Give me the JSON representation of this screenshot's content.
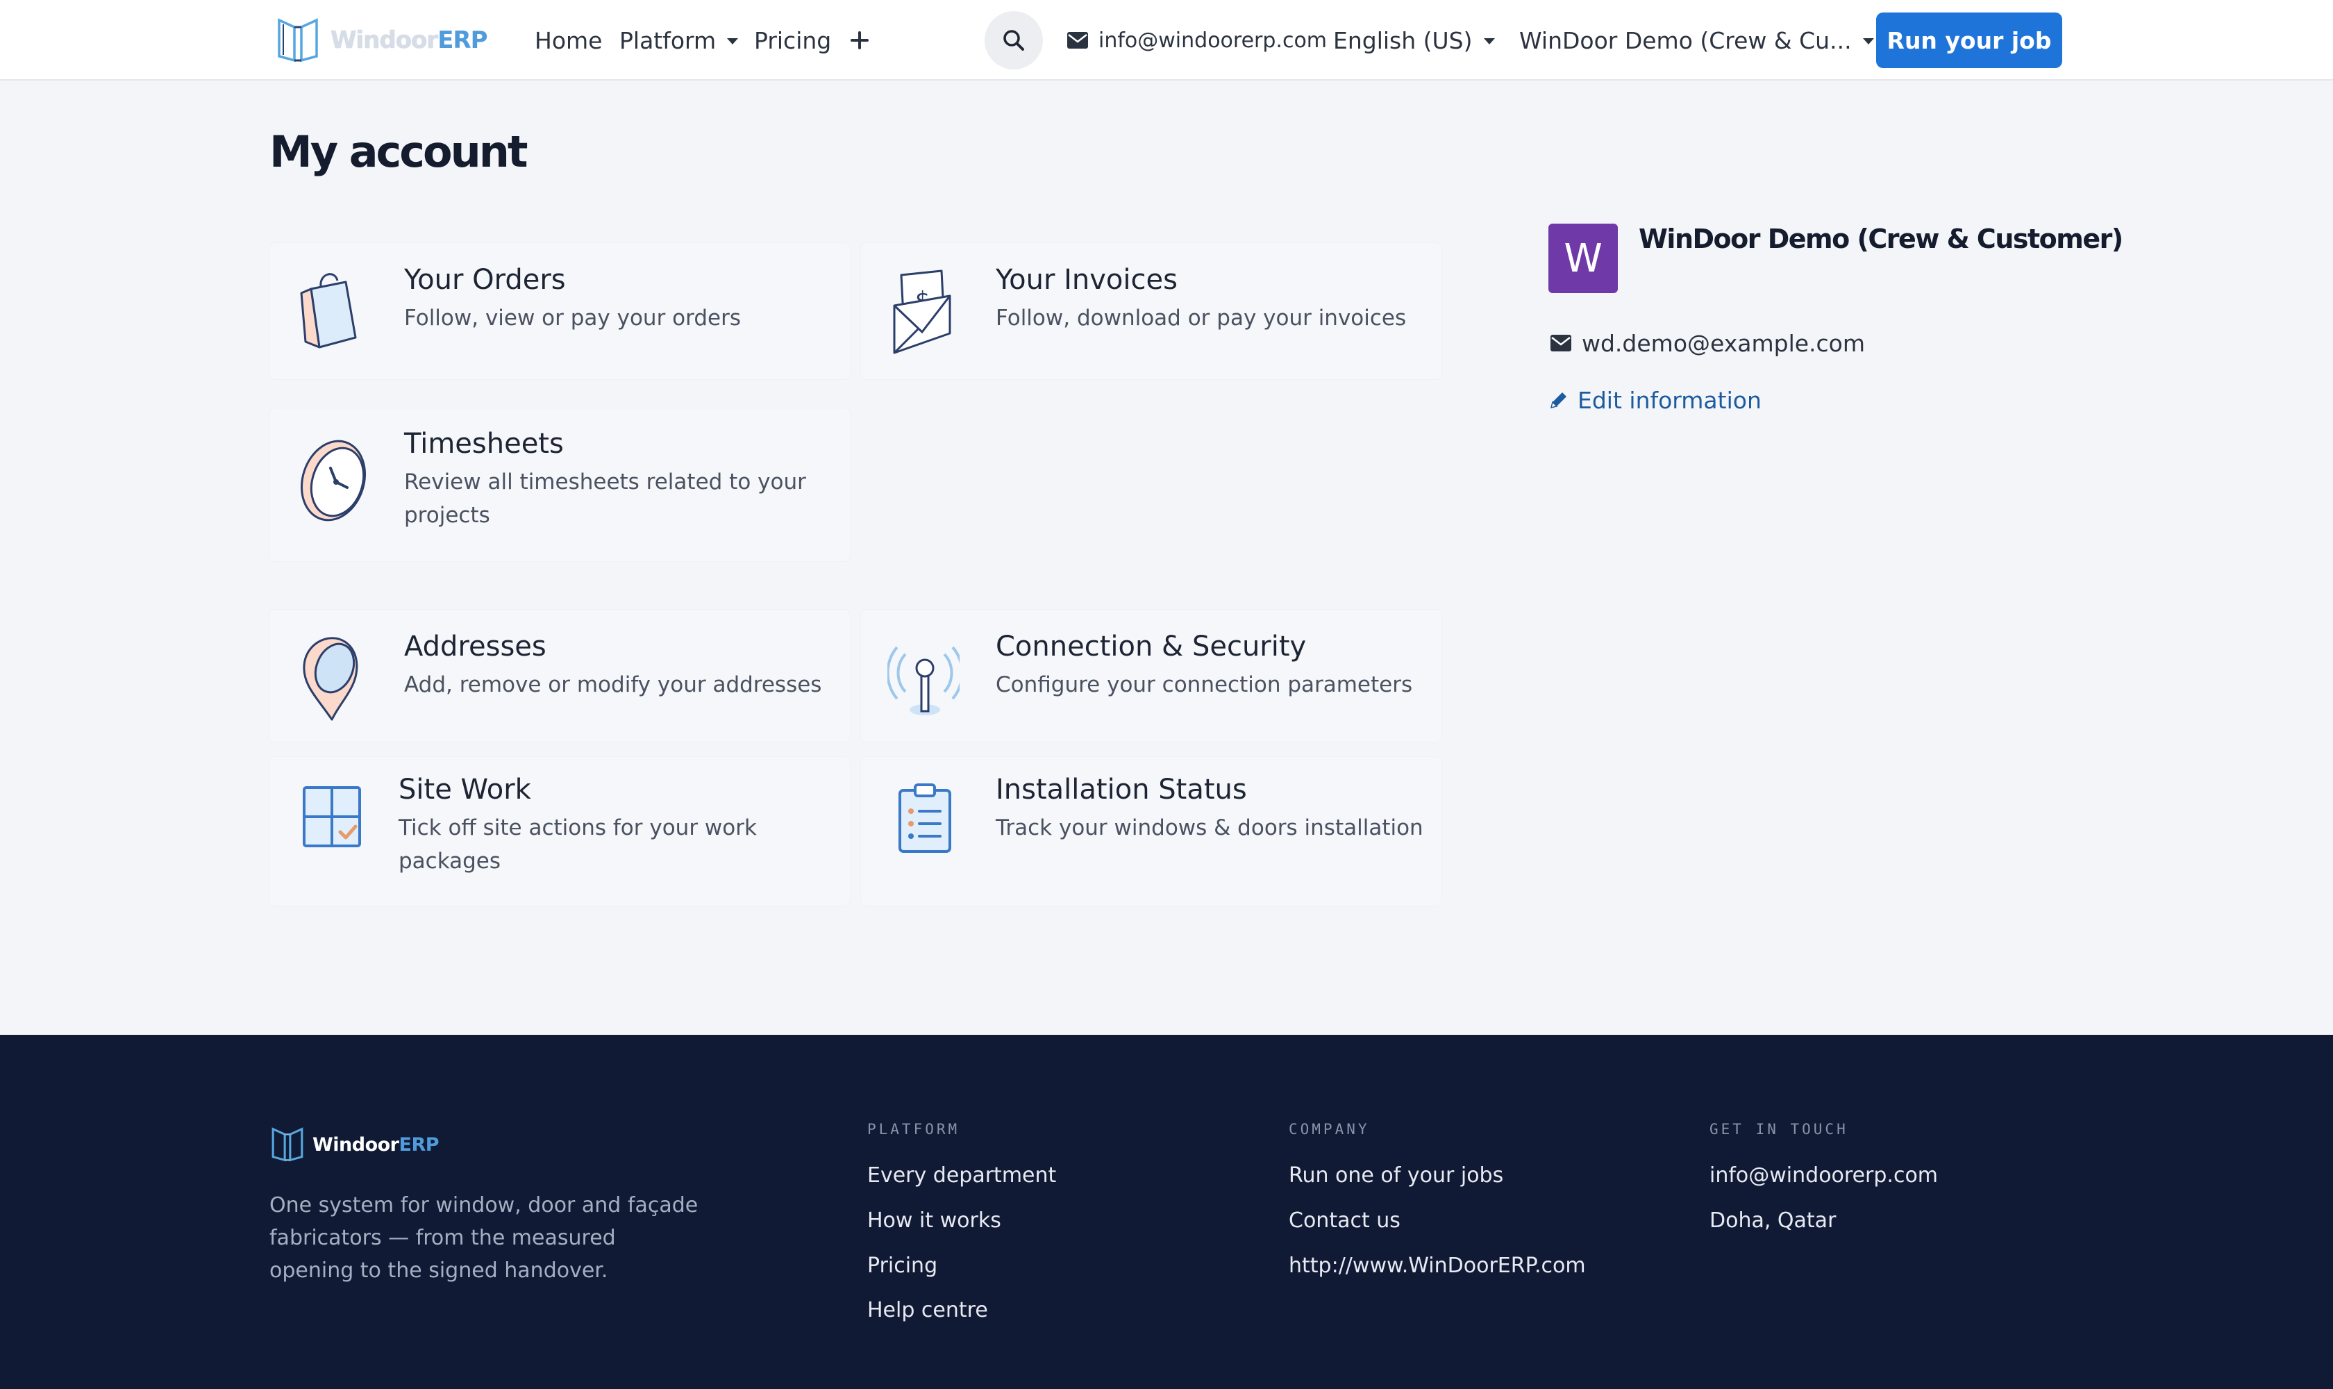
{
  "nav": {
    "brand_part1": "Windoor",
    "brand_part2": "ERP",
    "home": "Home",
    "platform": "Platform",
    "pricing": "Pricing",
    "email": "info@windoorerp.com",
    "language": "English (US)",
    "account": "WinDoor Demo (Crew & Cu...",
    "cta": "Run your job"
  },
  "page": {
    "title": "My account"
  },
  "cards": {
    "orders": {
      "title": "Your Orders",
      "desc": "Follow, view or pay your orders"
    },
    "invoices": {
      "title": "Your Invoices",
      "desc": "Follow, download or pay your invoices"
    },
    "timesheets": {
      "title": "Timesheets",
      "desc": "Review all timesheets related to your projects"
    },
    "addresses": {
      "title": "Addresses",
      "desc": "Add, remove or modify your addresses"
    },
    "security": {
      "title": "Connection & Security",
      "desc": "Configure your connection parameters"
    },
    "sitework": {
      "title": "Site Work",
      "desc": "Tick off site actions for your work packages"
    },
    "installation": {
      "title": "Installation Status",
      "desc": "Track your windows & doors installation"
    }
  },
  "profile": {
    "initial": "W",
    "name": "WinDoor Demo (Crew & Customer)",
    "email": "wd.demo@example.com",
    "edit": "Edit information"
  },
  "footer": {
    "brand_part1": "Windoor",
    "brand_part2": "ERP",
    "tagline": "One system for window, door and façade fabricators — from the measured opening to the signed handover.",
    "platform": {
      "heading": "PLATFORM",
      "links": [
        "Every department",
        "How it works",
        "Pricing",
        "Help centre"
      ]
    },
    "company": {
      "heading": "COMPANY",
      "links": [
        "Run one of your jobs",
        "Contact us",
        "http://www.WinDoorERP.com"
      ]
    },
    "contact": {
      "heading": "GET IN TOUCH",
      "links": [
        "info@windoorerp.com",
        "Doha, Qatar"
      ]
    }
  },
  "colors": {
    "primary": "#1f74d9",
    "avatar": "#6f3aa8",
    "footer_bg": "#111a34",
    "page_bg": "#f3f5f9",
    "link": "#1c5ba0"
  }
}
